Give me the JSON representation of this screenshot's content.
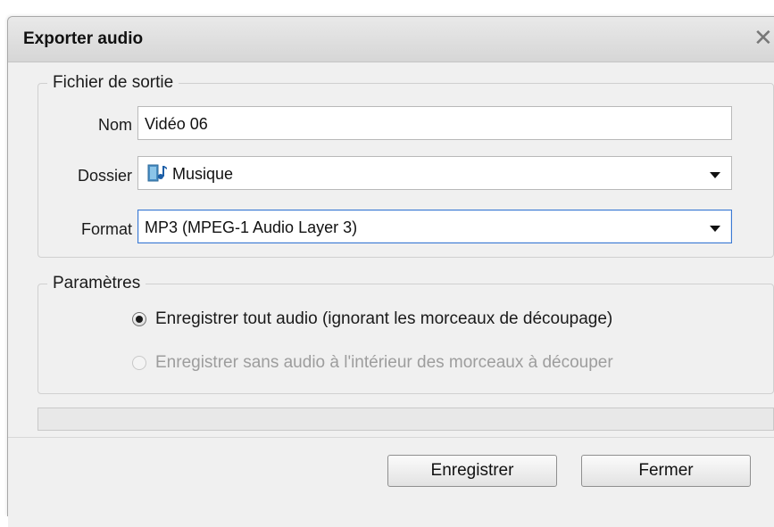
{
  "dialog": {
    "title": "Exporter audio",
    "close_icon": "close-icon"
  },
  "output_group": {
    "legend": "Fichier de sortie",
    "name_label": "Nom",
    "name_value": "Vidéo 06",
    "folder_label": "Dossier",
    "folder_value": "Musique",
    "folder_icon": "music-folder-icon",
    "format_label": "Format",
    "format_value": "MP3 (MPEG-1 Audio Layer 3)"
  },
  "params_group": {
    "legend": "Paramètres",
    "option1": {
      "label": "Enregistrer tout audio (ignorant les morceaux de découpage)",
      "checked": true,
      "enabled": true
    },
    "option2": {
      "label": "Enregistrer sans audio à l'intérieur des morceaux à découper",
      "checked": false,
      "enabled": false
    }
  },
  "progress": {
    "value": 0
  },
  "buttons": {
    "save": "Enregistrer",
    "close": "Fermer"
  }
}
